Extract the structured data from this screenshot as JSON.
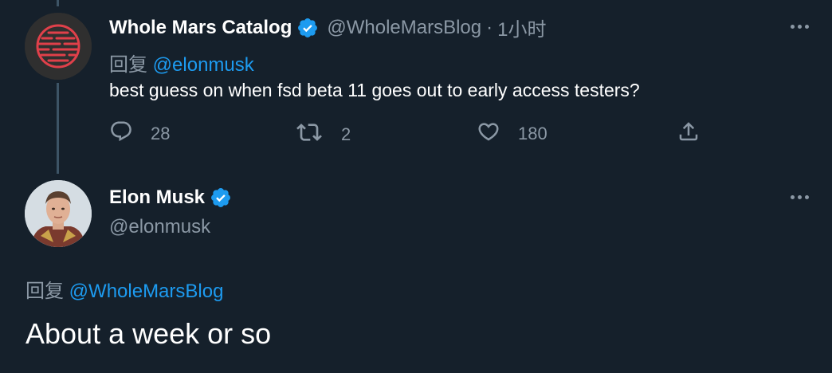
{
  "tweet1": {
    "display_name": "Whole Mars Catalog",
    "handle": "@WholeMarsBlog",
    "separator": "·",
    "time": "1小时",
    "reply_prefix": "回复",
    "reply_mention": "@elonmusk",
    "text": "best guess on when fsd beta 11 goes out to early access testers?",
    "actions": {
      "reply_count": "28",
      "retweet_count": "2",
      "like_count": "180"
    }
  },
  "tweet2": {
    "display_name": "Elon Musk",
    "handle": "@elonmusk",
    "reply_prefix": "回复",
    "reply_mention": "@WholeMarsBlog",
    "text": "About a week or so"
  },
  "colors": {
    "background": "#15202b",
    "text_primary": "#ffffff",
    "text_secondary": "#8b98a5",
    "link": "#1d9bf0",
    "verified": "#1d9bf0",
    "thread_line": "#3d5466"
  },
  "icons": [
    "verified-badge-icon",
    "more-options-icon",
    "reply-icon",
    "retweet-icon",
    "like-icon",
    "share-icon"
  ]
}
